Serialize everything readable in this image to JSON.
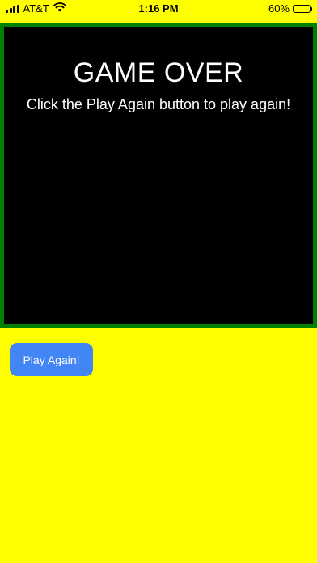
{
  "status_bar": {
    "carrier": "AT&T",
    "time": "1:16 PM",
    "battery_percent_label": "60%",
    "battery_level": 0.6,
    "icons": [
      "signal-bars-icon",
      "wifi-icon",
      "battery-icon"
    ]
  },
  "game": {
    "title": "GAME OVER",
    "message": "Click the Play Again button to play again!"
  },
  "controls": {
    "play_again_label": "Play Again!"
  },
  "colors": {
    "page_background": "#ffff00",
    "canvas_background": "#000000",
    "canvas_border": "#008000",
    "button_background": "#4285f4",
    "text_on_canvas": "#ffffff"
  }
}
